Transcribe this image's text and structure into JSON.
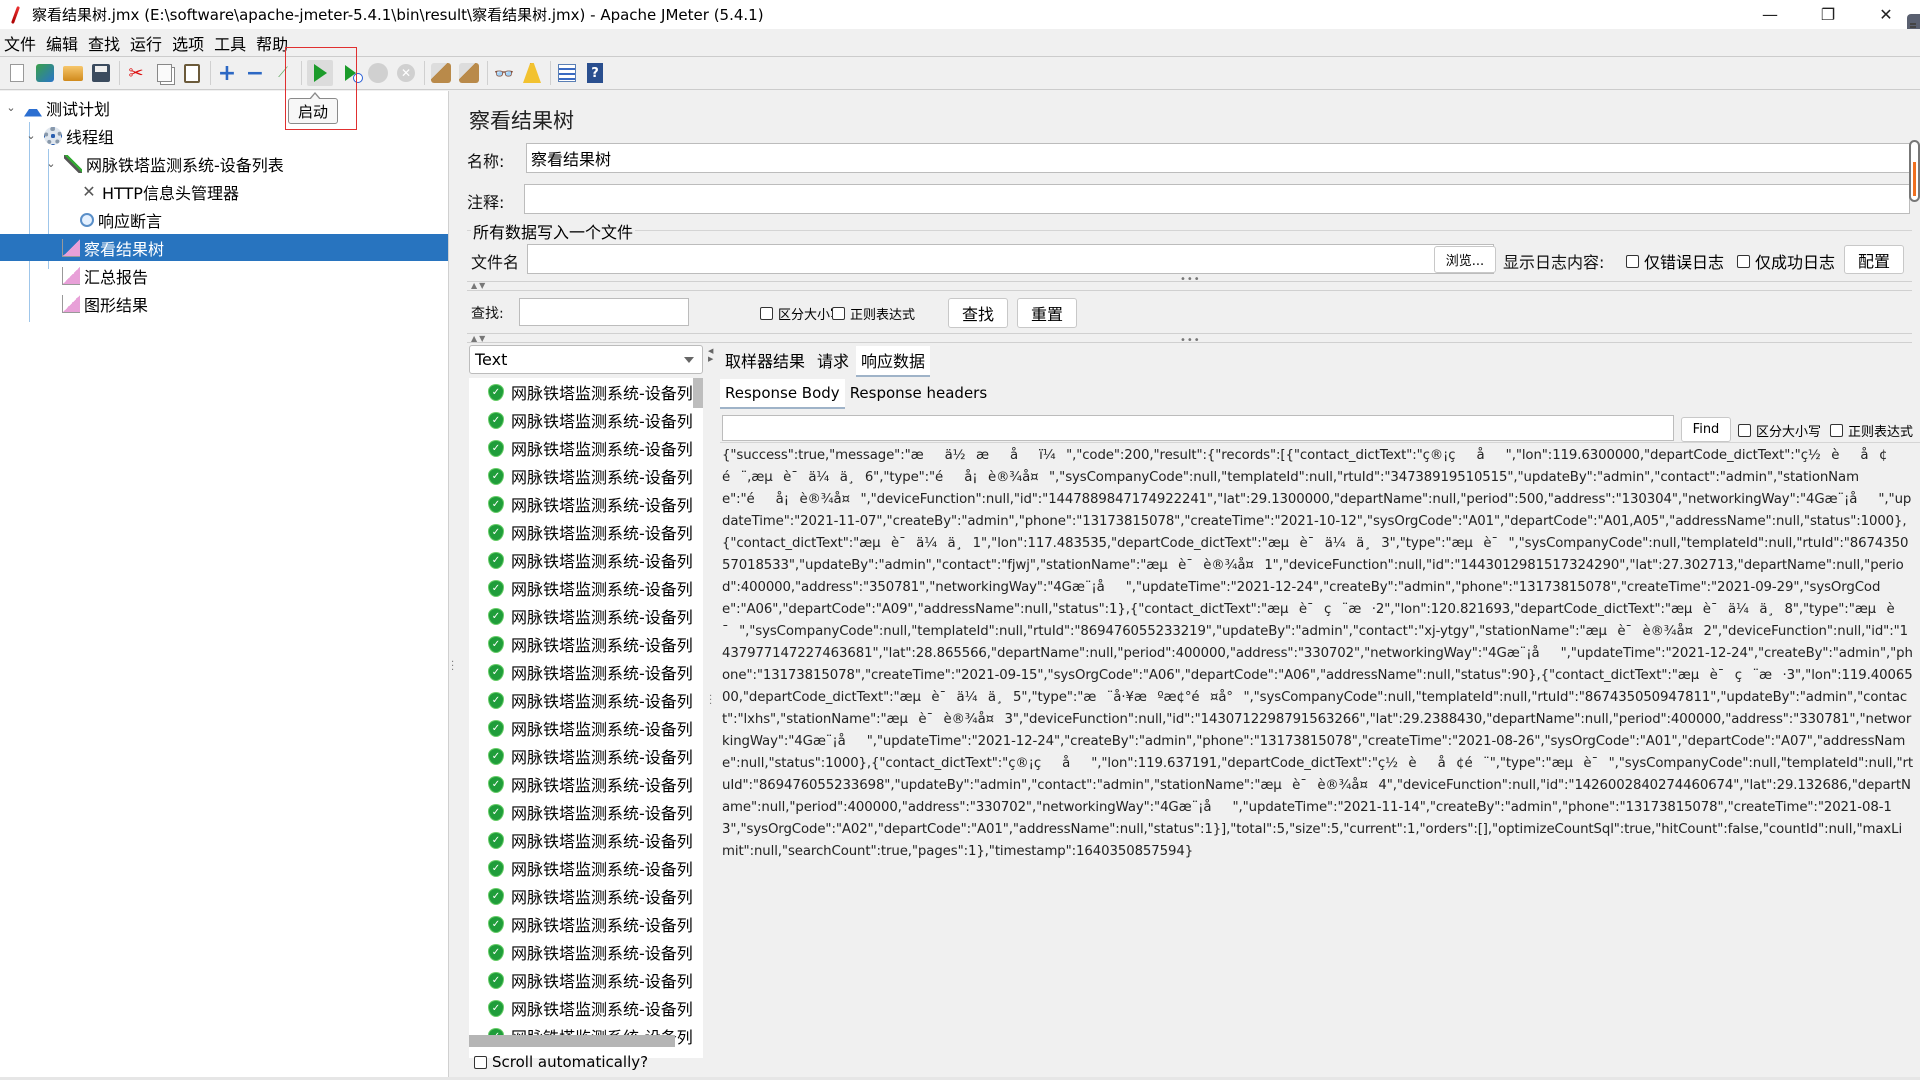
{
  "window": {
    "title": "察看结果树.jmx (E:\\software\\apache-jmeter-5.4.1\\bin\\result\\察看结果树.jmx) - Apache JMeter (5.4.1)",
    "controls": {
      "minimize": "—",
      "maximize": "❐",
      "close": "✕"
    }
  },
  "menu": [
    "文件",
    "编辑",
    "查找",
    "运行",
    "选项",
    "工具",
    "帮助"
  ],
  "toolbar": {
    "icons": [
      "new-icon",
      "templates-icon",
      "open-icon",
      "save-icon",
      "cut-icon",
      "copy-icon",
      "paste-icon",
      "expand-icon",
      "collapse-icon",
      "toggle-icon",
      "start-icon",
      "start-no-pause-icon",
      "stop-icon",
      "shutdown-icon",
      "clear-icon",
      "clear-all-icon",
      "search-icon",
      "reset-search-icon",
      "function-helper-icon",
      "help-icon"
    ],
    "tooltip": "启动"
  },
  "tree": {
    "items": [
      {
        "label": "测试计划",
        "icon": "test-plan-icon",
        "expanded": true
      },
      {
        "label": "线程组",
        "icon": "thread-group-icon",
        "expanded": true
      },
      {
        "label": "网脉铁塔监测系统-设备列表",
        "icon": "http-sampler-icon",
        "expanded": true
      },
      {
        "label": "HTTP信息头管理器",
        "icon": "header-manager-icon"
      },
      {
        "label": "响应断言",
        "icon": "assertion-icon"
      },
      {
        "label": "察看结果树",
        "icon": "listener-icon",
        "selected": true
      },
      {
        "label": "汇总报告",
        "icon": "listener-icon"
      },
      {
        "label": "图形结果",
        "icon": "listener-icon"
      }
    ]
  },
  "panel": {
    "title": "察看结果树",
    "name_label": "名称:",
    "name_value": "察看结果树",
    "comment_label": "注释:",
    "comment_value": "",
    "group_label": "所有数据写入一个文件",
    "filename_label": "文件名",
    "filename_value": "",
    "browse_button": "浏览...",
    "log_content_label": "显示日志内容:",
    "errors_only": "仅错误日志",
    "success_only": "仅成功日志",
    "configure_button": "配置",
    "search_label": "查找:",
    "search_value": "",
    "case_sensitive": "区分大小写",
    "regex": "正则表达式",
    "search_button": "查找",
    "reset_button": "重置"
  },
  "results": {
    "renderer": "Text",
    "item_label": "网脉铁塔监测系统-设备列",
    "item_count_visible": 24,
    "scroll_auto_label": "Scroll automatically?",
    "tabs": [
      "取样器结果",
      "请求",
      "响应数据"
    ],
    "active_tab": 2,
    "subtabs": [
      "Response Body",
      "Response headers"
    ],
    "active_subtab": 0,
    "find_value": "",
    "find_button": "Find",
    "find_case_sensitive": "区分大小写",
    "find_regex": "正则表达式",
    "body": "{\"success\":true,\"message\":\"æä½æåï¼\",\"code\":200,\"result\":{\"records\":[{\"contact_dictText\":\"ç®¡çå\",\"lon\":119.6300000,\"departCode_dictText\":\"ç½èå¢é¨,æµè¯ä¼ä¸6\",\"type\":\"éå¡è®¾å¤\",\"sysCompanyCode\":null,\"templateId\":null,\"rtuId\":\"34738919510515\",\"updateBy\":\"admin\",\"contact\":\"admin\",\"stationName\":\"éå¡è®¾å¤\",\"deviceFunction\":null,\"id\":\"1447889847174922241\",\"lat\":29.1300000,\"departName\":null,\"period\":500,\"address\":\"130304\",\"networkingWay\":\"4Gæ¨¡å\",\"updateTime\":\"2021-11-07\",\"createBy\":\"admin\",\"phone\":\"13173815078\",\"createTime\":\"2021-10-12\",\"sysOrgCode\":\"A01\",\"departCode\":\"A01,A05\",\"addressName\":null,\"status\":1000},{\"contact_dictText\":\"æµè¯ä¼ä¸1\",\"lon\":117.483535,\"departCode_dictText\":\"æµè¯ä¼ä¸3\",\"type\":\"æµè¯\",\"sysCompanyCode\":null,\"templateId\":null,\"rtuId\":\"867435057018533\",\"updateBy\":\"admin\",\"contact\":\"fjwj\",\"stationName\":\"æµè¯è®¾å¤1\",\"deviceFunction\":null,\"id\":\"1443012981517324290\",\"lat\":27.302713,\"departName\":null,\"period\":400000,\"address\":\"350781\",\"networkingWay\":\"4Gæ¨¡å\",\"updateTime\":\"2021-12-24\",\"createBy\":\"admin\",\"phone\":\"13173815078\",\"createTime\":\"2021-09-29\",\"sysOrgCode\":\"A06\",\"departCode\":\"A09\",\"addressName\":null,\"status\":1},{\"contact_dictText\":\"æµè¯ç¨æ·2\",\"lon\":120.821693,\"departCode_dictText\":\"æµè¯ä¼ä¸8\",\"type\":\"æµè¯\",\"sysCompanyCode\":null,\"templateId\":null,\"rtuId\":\"869476055233219\",\"updateBy\":\"admin\",\"contact\":\"xj-ytgy\",\"stationName\":\"æµè¯è®¾å¤2\",\"deviceFunction\":null,\"id\":\"1437977147227463681\",\"lat\":28.865566,\"departName\":null,\"period\":400000,\"address\":\"330702\",\"networkingWay\":\"4Gæ¨¡å\",\"updateTime\":\"2021-12-24\",\"createBy\":\"admin\",\"phone\":\"13173815078\",\"createTime\":\"2021-09-15\",\"sysOrgCode\":\"A06\",\"departCode\":\"A06\",\"addressName\":null,\"status\":90},{\"contact_dictText\":\"æµè¯ç¨æ·3\",\"lon\":119.4006500,\"departCode_dictText\":\"æµè¯ä¼ä¸5\",\"type\":\"æ¨å·¥æºæ¢°é¤å°\",\"sysCompanyCode\":null,\"templateId\":null,\"rtuId\":\"867435050947811\",\"updateBy\":\"admin\",\"contact\":\"lxhs\",\"stationName\":\"æµè¯è®¾å¤3\",\"deviceFunction\":null,\"id\":\"1430712298791563266\",\"lat\":29.2388430,\"departName\":null,\"period\":400000,\"address\":\"330781\",\"networkingWay\":\"4Gæ¨¡å\",\"updateTime\":\"2021-12-24\",\"createBy\":\"admin\",\"phone\":\"13173815078\",\"createTime\":\"2021-08-26\",\"sysOrgCode\":\"A01\",\"departCode\":\"A07\",\"addressName\":null,\"status\":1000},{\"contact_dictText\":\"ç®¡çå\",\"lon\":119.637191,\"departCode_dictText\":\"ç½èå¢é¨\",\"type\":\"æµè¯\",\"sysCompanyCode\":null,\"templateId\":null,\"rtuId\":\"869476055233698\",\"updateBy\":\"admin\",\"contact\":\"admin\",\"stationName\":\"æµè¯è®¾å¤4\",\"deviceFunction\":null,\"id\":\"1426002840274460674\",\"lat\":29.132686,\"departName\":null,\"period\":400000,\"address\":\"330702\",\"networkingWay\":\"4Gæ¨¡å\",\"updateTime\":\"2021-11-14\",\"createBy\":\"admin\",\"phone\":\"13173815078\",\"createTime\":\"2021-08-13\",\"sysOrgCode\":\"A02\",\"departCode\":\"A01\",\"addressName\":null,\"status\":1}],\"total\":5,\"size\":5,\"current\":1,\"orders\":[],\"optimizeCountSql\":true,\"hitCount\":false,\"countId\":null,\"maxLimit\":null,\"searchCount\":true,\"pages\":1},\"timestamp\":1640350857594}"
  },
  "colors": {
    "selection": "#2874bf",
    "highlight_box": "#e03030",
    "success_icon": "#1f9d3a"
  }
}
